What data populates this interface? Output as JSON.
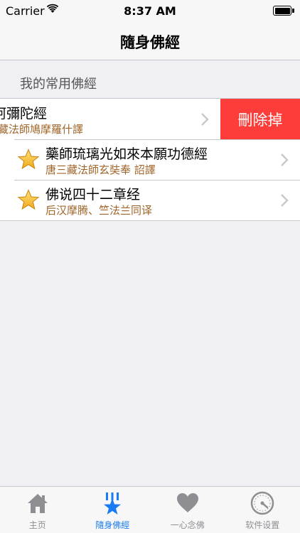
{
  "status_bar": {
    "carrier": "Carrier",
    "time": "8:37 AM"
  },
  "nav": {
    "title": "隨身佛經"
  },
  "section": {
    "header": "我的常用佛經"
  },
  "sutras": [
    {
      "title": "佛說阿彌陀經",
      "subtitle": "姚秦三藏法師鳩摩羅什譯",
      "swiped": true
    },
    {
      "title": "藥師琉璃光如來本願功德經",
      "subtitle": "唐三藏法師玄奘奉 詔譯"
    },
    {
      "title": "佛说四十二章经",
      "subtitle": "后汉摩腾、竺法兰同译"
    }
  ],
  "delete_label": "刪除掉",
  "tabs": [
    {
      "label": "主页",
      "icon": "home-icon"
    },
    {
      "label": "隨身佛經",
      "icon": "star-book-icon",
      "active": true
    },
    {
      "label": "一心念佛",
      "icon": "heart-icon"
    },
    {
      "label": "软件设置",
      "icon": "gauge-settings-icon"
    }
  ],
  "colors": {
    "accent": "#1a7cf5",
    "delete": "#fc3d39",
    "subtitle": "#a0652a"
  }
}
